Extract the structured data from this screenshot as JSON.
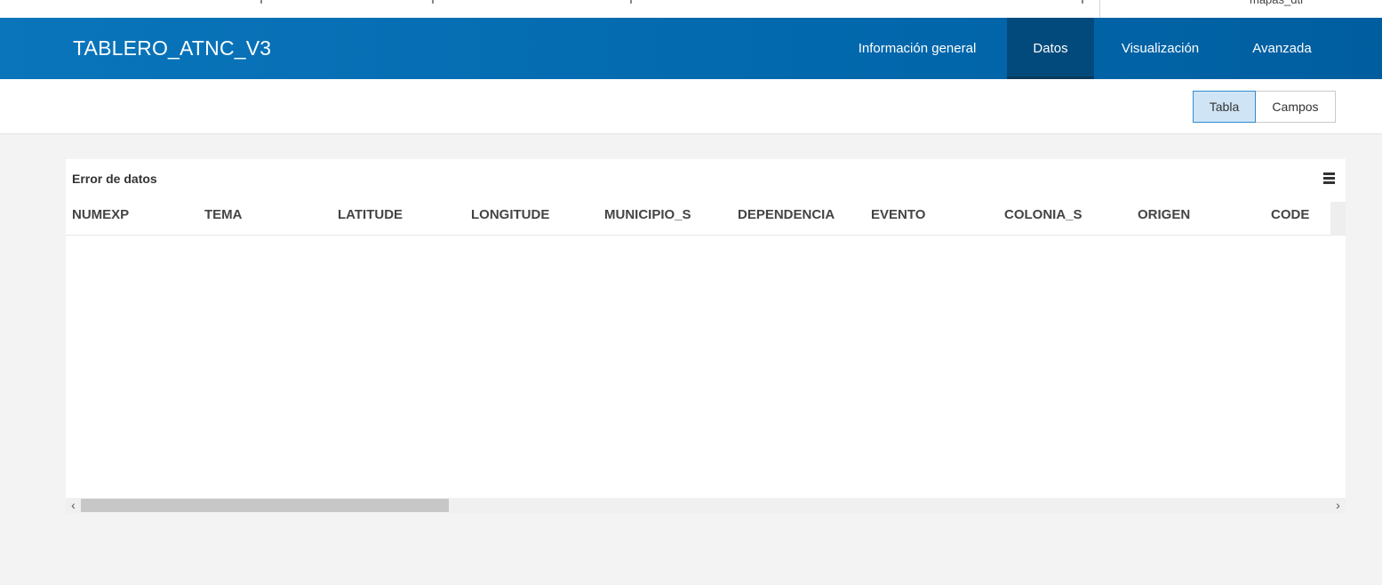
{
  "top_bar": {
    "username": "mapas_dti"
  },
  "header": {
    "title": "TABLERO_ATNC_V3",
    "nav": [
      {
        "label": "Información general",
        "active": false
      },
      {
        "label": "Datos",
        "active": true
      },
      {
        "label": "Visualización",
        "active": false
      },
      {
        "label": "Avanzada",
        "active": false
      }
    ]
  },
  "view_toggle": {
    "tabla_label": "Tabla",
    "campos_label": "Campos",
    "selected": "Tabla"
  },
  "table": {
    "title": "Error de datos",
    "columns": [
      "NUMEXP",
      "TEMA",
      "LATITUDE",
      "LONGITUDE",
      "MUNICIPIO_S",
      "DEPENDENCIA",
      "EVENTO",
      "COLONIA_S",
      "ORIGEN",
      "CODE"
    ],
    "rows": []
  },
  "colors": {
    "header_blue": "#0268ad",
    "active_tab": "#024a7c",
    "selected_toggle": "#cfe5f6",
    "page_background": "#f3f3f3"
  }
}
